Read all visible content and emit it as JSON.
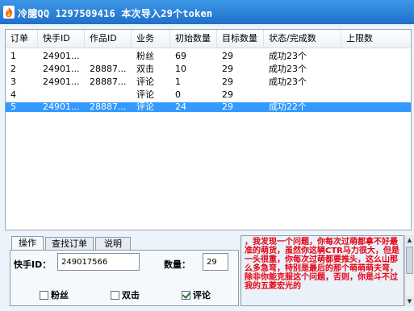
{
  "window": {
    "title": "冷臆QQ  1297509416  本次导入29个token",
    "icon": "fire-app-icon"
  },
  "table": {
    "columns": [
      "订单",
      "快手ID",
      "作品ID",
      "业务",
      "初始数量",
      "目标数量",
      "状态/完成数",
      "上限数"
    ],
    "rows": [
      {
        "order": "1",
        "kuaishou_id": "24901...",
        "work_id": "",
        "service": "粉丝",
        "initial": "69",
        "target": "29",
        "status": "成功23个",
        "limit": "",
        "selected": false
      },
      {
        "order": "2",
        "kuaishou_id": "24901...",
        "work_id": "28887...",
        "service": "双击",
        "initial": "10",
        "target": "29",
        "status": "成功23个",
        "limit": "",
        "selected": false
      },
      {
        "order": "3",
        "kuaishou_id": "24901...",
        "work_id": "28887...",
        "service": "评论",
        "initial": "1",
        "target": "29",
        "status": "成功23个",
        "limit": "",
        "selected": false
      },
      {
        "order": "4",
        "kuaishou_id": "",
        "work_id": "",
        "service": "评论",
        "initial": "0",
        "target": "29",
        "status": "",
        "limit": "",
        "selected": false
      },
      {
        "order": "5",
        "kuaishou_id": "24901...",
        "work_id": "28887...",
        "service": "评论",
        "initial": "24",
        "target": "29",
        "status": "成功22个",
        "limit": "",
        "selected": true
      }
    ]
  },
  "tabs": [
    "操作",
    "查找订单",
    "说明"
  ],
  "form": {
    "kuaishou_id_label": "快手ID：",
    "kuaishou_id_value": "249017566",
    "quantity_label": "数量：",
    "quantity_value": "29",
    "checkboxes": [
      {
        "label": "粉丝",
        "checked": false
      },
      {
        "label": "双击",
        "checked": false
      },
      {
        "label": "评论",
        "checked": true
      }
    ]
  },
  "notice": {
    "text": "，我发现一个问题，你每次过萌都拿不好最准的萌货，虽然你这辆CTR马力很大，但是一头很重，你每次过萌都要推头，这么山那么多急弯，特别是最后的那个萌萌萌夫弯，除非你能克服这个问题，否则，你是斗不过我的五菱宏光的"
  },
  "colors": {
    "titlebar": "#2b82d9",
    "selection": "#3399ff",
    "notice_text": "#e60012"
  }
}
